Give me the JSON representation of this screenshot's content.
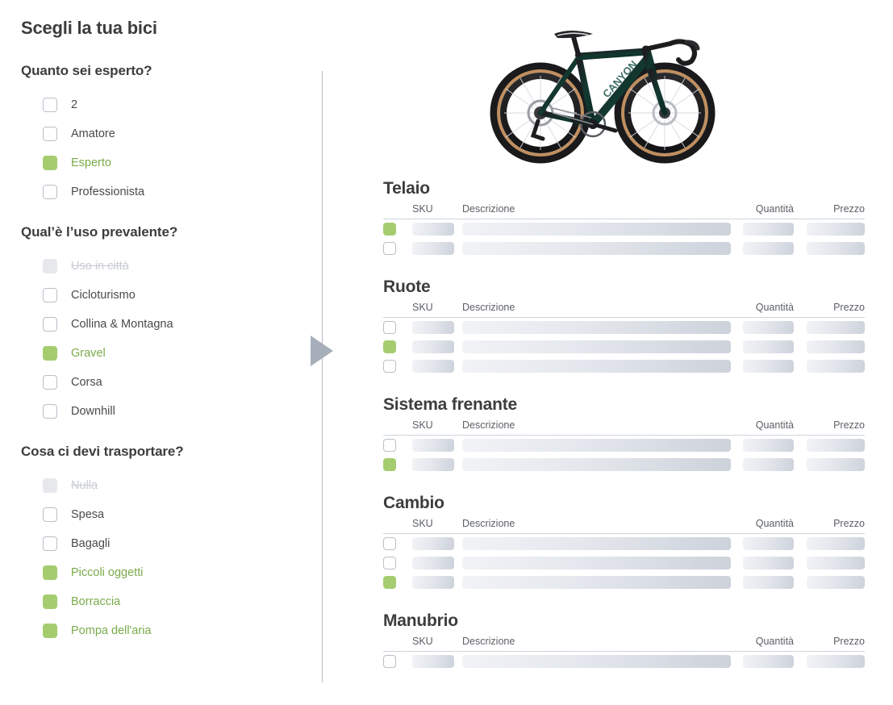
{
  "page": {
    "title": "Scegli la tua bici"
  },
  "colors": {
    "accent_green": "#a5cd6f",
    "accent_green_text": "#7aab4a",
    "checkbox_border": "#b9c0c8",
    "disabled_fill": "#e6e8ec",
    "divider": "#b6bcc4",
    "arrow": "#a7afba",
    "heading": "#3d3d3d",
    "skeleton_from": "#f1f3f6",
    "skeleton_to": "#cdd2db"
  },
  "questions": [
    {
      "title": "Quanto sei esperto?",
      "options": [
        {
          "label": "2",
          "state": "unchecked"
        },
        {
          "label": "Amatore",
          "state": "unchecked"
        },
        {
          "label": "Esperto",
          "state": "checked"
        },
        {
          "label": "Professionista",
          "state": "unchecked"
        }
      ]
    },
    {
      "title": "Qual’è l’uso prevalente?",
      "options": [
        {
          "label": "Uso in città",
          "state": "disabled"
        },
        {
          "label": "Cicloturismo",
          "state": "unchecked"
        },
        {
          "label": "Collina & Montagna",
          "state": "unchecked"
        },
        {
          "label": "Gravel",
          "state": "checked"
        },
        {
          "label": "Corsa",
          "state": "unchecked"
        },
        {
          "label": "Downhill",
          "state": "unchecked"
        }
      ]
    },
    {
      "title": "Cosa ci devi trasportare?",
      "options": [
        {
          "label": "Nulla",
          "state": "disabled"
        },
        {
          "label": "Spesa",
          "state": "unchecked"
        },
        {
          "label": "Bagagli",
          "state": "unchecked"
        },
        {
          "label": "Piccoli oggetti",
          "state": "checked"
        },
        {
          "label": "Borraccia",
          "state": "checked"
        },
        {
          "label": "Pompa dell'aria",
          "state": "checked"
        }
      ]
    }
  ],
  "preview": {
    "image_name": "gravel-bike-photo",
    "alt": "Bicicletta gravel telaio verde scuro"
  },
  "table_columns": {
    "checkbox": "",
    "sku": "SKU",
    "description": "Descrizione",
    "quantity": "Quantità",
    "price": "Prezzo"
  },
  "sections": [
    {
      "title": "Telaio",
      "rows": [
        {
          "selected": true,
          "sku": "",
          "description": "",
          "quantity": "",
          "price": ""
        },
        {
          "selected": false,
          "sku": "",
          "description": "",
          "quantity": "",
          "price": ""
        }
      ]
    },
    {
      "title": "Ruote",
      "rows": [
        {
          "selected": false,
          "sku": "",
          "description": "",
          "quantity": "",
          "price": ""
        },
        {
          "selected": true,
          "sku": "",
          "description": "",
          "quantity": "",
          "price": ""
        },
        {
          "selected": false,
          "sku": "",
          "description": "",
          "quantity": "",
          "price": ""
        }
      ]
    },
    {
      "title": "Sistema frenante",
      "rows": [
        {
          "selected": false,
          "sku": "",
          "description": "",
          "quantity": "",
          "price": ""
        },
        {
          "selected": true,
          "sku": "",
          "description": "",
          "quantity": "",
          "price": ""
        }
      ]
    },
    {
      "title": "Cambio",
      "rows": [
        {
          "selected": false,
          "sku": "",
          "description": "",
          "quantity": "",
          "price": ""
        },
        {
          "selected": false,
          "sku": "",
          "description": "",
          "quantity": "",
          "price": ""
        },
        {
          "selected": true,
          "sku": "",
          "description": "",
          "quantity": "",
          "price": ""
        }
      ]
    },
    {
      "title": "Manubrio",
      "rows": [
        {
          "selected": false,
          "sku": "",
          "description": "",
          "quantity": "",
          "price": ""
        }
      ]
    }
  ],
  "nav": {
    "next_arrow": "triangle-right-icon"
  }
}
